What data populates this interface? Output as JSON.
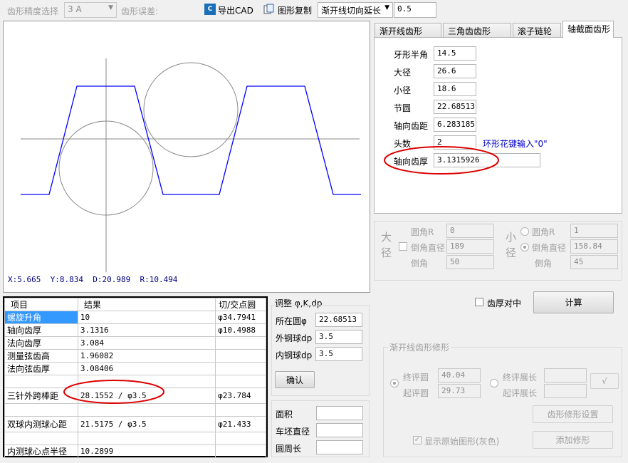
{
  "toolbar": {
    "precision_label": "齿形精度选择",
    "precision_value": "3  A",
    "error_label": "齿形误差:",
    "export_cad": "导出CAD",
    "copy_shape": "图形复制",
    "extend_mode": "渐开线切向延长",
    "extend_value": "0.5"
  },
  "canvas": {
    "status": {
      "x": "X:5.665",
      "y": "Y:8.834",
      "d": "D:20.989",
      "r": "R:10.494"
    }
  },
  "tabs": [
    "渐开线齿形",
    "三角齿齿形",
    "滚子链轮",
    "轴截面齿形"
  ],
  "params": [
    {
      "label": "牙形半角",
      "value": "14.5"
    },
    {
      "label": "大径",
      "value": "26.6"
    },
    {
      "label": "小径",
      "value": "18.6"
    },
    {
      "label": "节圆",
      "value": "22.68513"
    },
    {
      "label": "轴向齿距",
      "value": "6.283185"
    },
    {
      "label": "头数",
      "value": "2"
    },
    {
      "label": "轴向齿厚",
      "value": "3.1315926"
    }
  ],
  "params_hint": "环形花键输入\"0\"",
  "fillet": {
    "major": {
      "title": "大径",
      "r_label": "圆角R",
      "r_value": "0",
      "chamfer_label": "倒角直径",
      "chamfer_value": "189",
      "angle_label": "倒角",
      "angle_value": "50"
    },
    "minor": {
      "title": "小径",
      "r_label": "圆角R",
      "r_value": "1",
      "chamfer_label": "倒角直径",
      "chamfer_value": "158.84",
      "angle_label": "倒角",
      "angle_value": "45"
    }
  },
  "center_thickness_label": "齿厚对中",
  "calc_button": "计算",
  "results": {
    "headers": [
      "项目",
      "结果",
      "切/交点圆"
    ],
    "rows": [
      {
        "item": "螺旋升角",
        "result": "10",
        "circle": "φ34.7941"
      },
      {
        "item": "轴向齿厚",
        "result": "3.1316",
        "circle": "φ10.4988"
      },
      {
        "item": "法向齿厚",
        "result": "3.084",
        "circle": ""
      },
      {
        "item": "测量弦齿高",
        "result": "1.96082",
        "circle": ""
      },
      {
        "item": "法向弦齿厚",
        "result": "3.08406",
        "circle": ""
      },
      {
        "item": "",
        "result": "",
        "circle": ""
      },
      {
        "item": "三针外跨棒距",
        "result": "28.1552 / φ3.5",
        "circle": "φ23.784"
      },
      {
        "item": "",
        "result": "",
        "circle": ""
      },
      {
        "item": "双球内测球心距",
        "result": "21.5175 / φ3.5",
        "circle": "φ21.433"
      },
      {
        "item": "",
        "result": "",
        "circle": ""
      },
      {
        "item": "内测球心点半径",
        "result": "10.2899",
        "circle": ""
      }
    ]
  },
  "adjust": {
    "title": "调整 φ,K,dp",
    "pitch_label": "所在圆φ",
    "pitch_value": "22.68513",
    "outer_label": "外钢球dp",
    "outer_value": "3.5",
    "inner_label": "内钢球dp",
    "inner_value": "3.5",
    "confirm": "确认"
  },
  "misc": {
    "area_label": "面积",
    "blank_dia_label": "车坯直径",
    "perimeter_label": "圆周长"
  },
  "modify": {
    "title": "渐开线齿形修形",
    "eval_circle": "终评圆",
    "start_circle": "起评圆",
    "eval_circle_value": "40.04",
    "start_circle_value": "29.73",
    "eval_length": "终评展长",
    "start_length": "起评展长",
    "check_label": "√",
    "settings": "齿形修形设置",
    "show_original": "显示原始图形(灰色)",
    "add_modify": "添加修形"
  },
  "colors": {
    "profile": "#0000ff",
    "annotation": "#dd0000",
    "hint": "#0000cc"
  }
}
